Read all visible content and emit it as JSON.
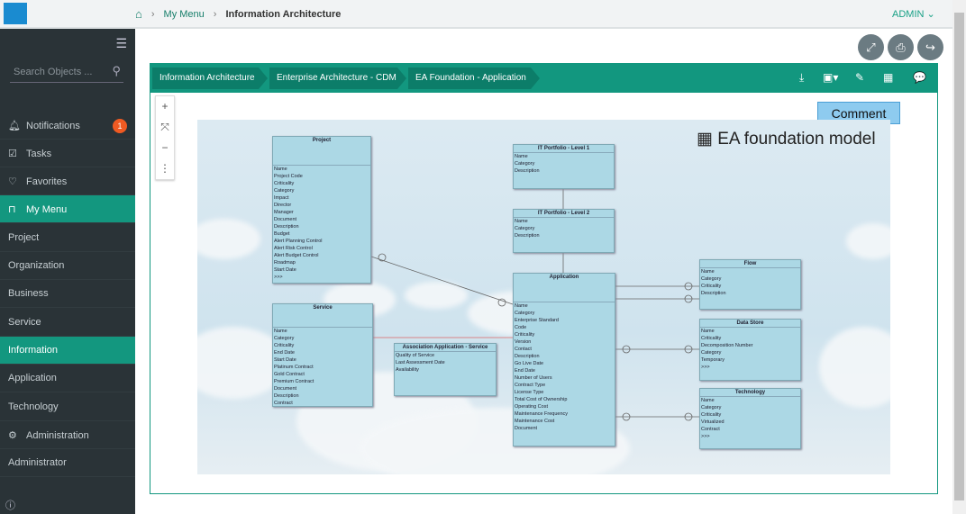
{
  "header": {
    "breadcrumb": [
      "My Menu",
      "Information Architecture"
    ],
    "user": "ADMIN"
  },
  "sidebar": {
    "search_placeholder": "Search Objects ...",
    "notifications_count": "1",
    "items": [
      {
        "label": "Notifications",
        "icon": "bell-icon"
      },
      {
        "label": "Tasks",
        "icon": "check-square-icon"
      },
      {
        "label": "Favorites",
        "icon": "heart-icon"
      },
      {
        "label": "My Menu",
        "icon": "bookmark-icon"
      },
      {
        "label": "Project"
      },
      {
        "label": "Organization"
      },
      {
        "label": "Business"
      },
      {
        "label": "Service"
      },
      {
        "label": "Information"
      },
      {
        "label": "Application"
      },
      {
        "label": "Technology"
      },
      {
        "label": "Administration",
        "icon": "gears-icon"
      },
      {
        "label": "Administrator"
      }
    ]
  },
  "panel": {
    "breadcrumb": [
      "Information Architecture",
      "Enterprise Architecture - CDM",
      "EA Foundation - Application"
    ],
    "tooltip": "Comment"
  },
  "diagram": {
    "logo": "EA foundation model",
    "entities": [
      {
        "name": "Project",
        "attrs": [
          "Name",
          "Project Code",
          "Criticality",
          "Category",
          "Impact",
          "Director",
          "Manager",
          "Document",
          "Description",
          "Budget",
          "Alert Planning Control",
          "Alert Risk Control",
          "Alert Budget Control",
          "Roadmap",
          "Start Date",
          ">>>"
        ]
      },
      {
        "name": "IT Portfolio - Level 1",
        "attrs": [
          "Name",
          "Category",
          "Description"
        ]
      },
      {
        "name": "IT Portfolio - Level 2",
        "attrs": [
          "Name",
          "Category",
          "Description"
        ]
      },
      {
        "name": "Application",
        "attrs": [
          "Name",
          "Category",
          "Enterprise Standard",
          "Code",
          "Criticality",
          "Version",
          "Contact",
          "Description",
          "Go Live Date",
          "End Date",
          "Number of Users",
          "Contract Type",
          "License Type",
          "Total Cost of Ownership",
          "Operating Cost",
          "Maintenance Frequency",
          "Maintenance Cost",
          "Document"
        ]
      },
      {
        "name": "Service",
        "attrs": [
          "Name",
          "Category",
          "Criticality",
          "End Date",
          "Start Date",
          "Platinum Contract",
          "Gold Contract",
          "Premium Contract",
          "Document",
          "Description",
          "Contract"
        ]
      },
      {
        "name": "Association Application - Service",
        "attrs": [
          "Quality of Service",
          "Last Assessment Date",
          "Availability"
        ]
      },
      {
        "name": "Flow",
        "attrs": [
          "Name",
          "Category",
          "Criticality",
          "Description"
        ]
      },
      {
        "name": "Data Store",
        "attrs": [
          "Name",
          "Criticality",
          "Decomposition Number",
          "Category",
          "Temporary",
          ">>>"
        ]
      },
      {
        "name": "Technology",
        "attrs": [
          "Name",
          "Category",
          "Criticality",
          "Virtualized",
          "Contract",
          ">>>"
        ]
      }
    ]
  }
}
